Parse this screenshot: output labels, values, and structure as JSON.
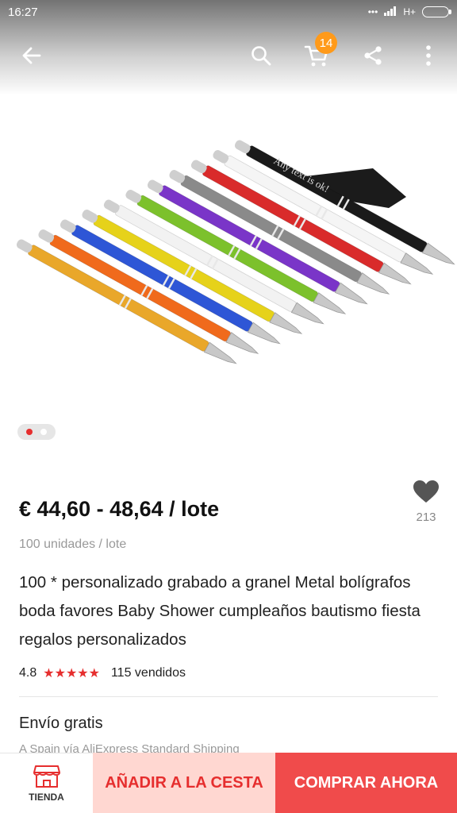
{
  "status_bar": {
    "time": "16:27",
    "network": "H+"
  },
  "nav": {
    "cart_count": "14"
  },
  "product": {
    "price": "€ 44,60 - 48,64 / lote",
    "unit": "100 unidades / lote",
    "wishlist_count": "213",
    "title": "100 * personalizado grabado a granel Metal bolígrafos boda favores Baby Shower cumpleaños bautismo fiesta regalos personalizados",
    "rating": "4.8",
    "stars": "★★★★★",
    "sold": "115 vendidos",
    "shipping_title": "Envío gratis",
    "shipping_detail": "A Spain vía AliExpress Standard Shipping",
    "image_text": "Any text is ok!"
  },
  "bottom_bar": {
    "store_label": "TIENDA",
    "add_to_cart": "AÑADIR A LA CESTA",
    "buy_now": "COMPRAR AHORA"
  },
  "colors": {
    "accent": "#e62e2e",
    "badge": "#ff9a1a",
    "add_to_cart_bg": "#ffd7d1",
    "buy_now_bg": "#f04b4b",
    "pens": [
      "#e9a72a",
      "#f06a1c",
      "#2e56d6",
      "#e6d21a",
      "#f2f2f2",
      "#7cc12c",
      "#7a35c8",
      "#8a8a8a",
      "#d92b2b",
      "#f5f5f5",
      "#1a1a1a"
    ]
  }
}
